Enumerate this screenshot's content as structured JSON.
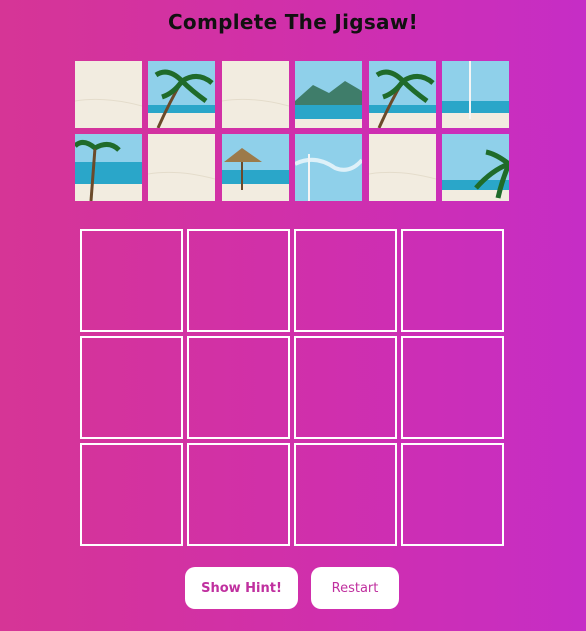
{
  "title": "Complete The Jigsaw!",
  "pieces": [
    {
      "kind": "sand"
    },
    {
      "kind": "palm"
    },
    {
      "kind": "sand"
    },
    {
      "kind": "mountain"
    },
    {
      "kind": "palm"
    },
    {
      "kind": "pole"
    },
    {
      "kind": "beach-palm"
    },
    {
      "kind": "sand"
    },
    {
      "kind": "hut"
    },
    {
      "kind": "sky-pole"
    },
    {
      "kind": "sand"
    },
    {
      "kind": "palm-corner"
    }
  ],
  "board": {
    "rows": 3,
    "cols": 4
  },
  "buttons": {
    "hint": "Show Hint!",
    "restart": "Restart"
  },
  "colors": {
    "accent": "#c0309f",
    "sky": "#8fd0ea",
    "sea": "#2aa6c9",
    "sand": "#f2ece0",
    "palm": "#1f6b2a"
  }
}
